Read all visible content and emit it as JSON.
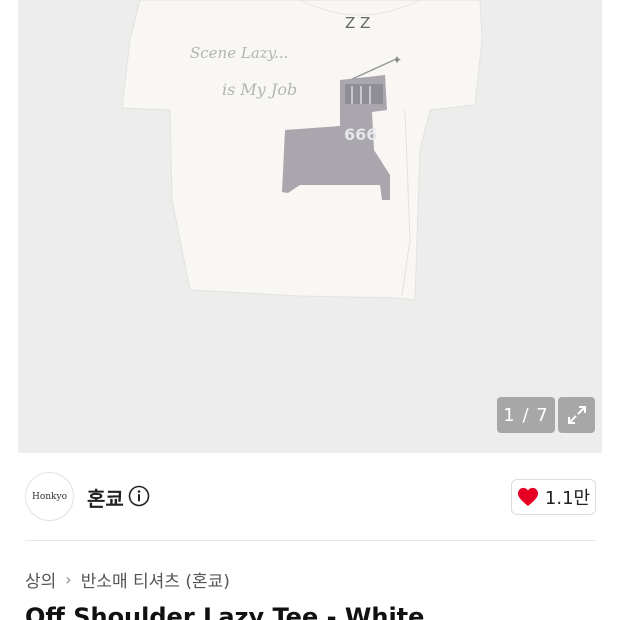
{
  "gallery": {
    "counter": "1 / 7",
    "image_text": {
      "line1": "Scene Lazy...",
      "line2": "is My Job",
      "bed_number": "666",
      "sleep": "Z Z"
    }
  },
  "brand": {
    "logo_text": "Honkyo",
    "name": "혼쿄",
    "likes": "1.1만"
  },
  "breadcrumb": {
    "level1": "상의",
    "level2": "반소매 티셔츠 (혼쿄)"
  },
  "product": {
    "title": "Off Shoulder Lazy Tee - White"
  },
  "colors": {
    "heart": "#e60023",
    "overlay": "#8c8c8c"
  }
}
